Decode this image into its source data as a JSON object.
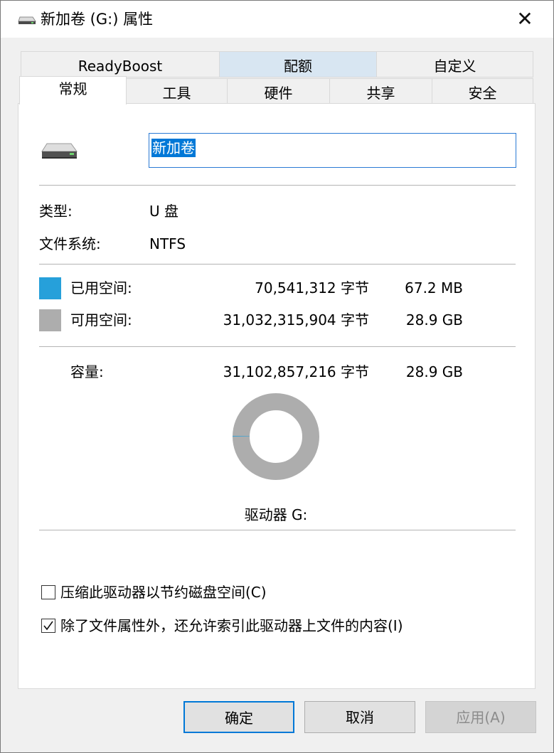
{
  "window": {
    "title": "新加卷 (G:) 属性",
    "close_symbol": "✕"
  },
  "tabs": {
    "row_back": [
      "ReadyBoost",
      "配额",
      "自定义"
    ],
    "row_front": [
      "常规",
      "工具",
      "硬件",
      "共享",
      "安全"
    ],
    "active": "常规",
    "hover": "配额"
  },
  "general": {
    "drive_icon": "usb-drive-icon",
    "volume_name": "新加卷",
    "type_label": "类型:",
    "type_value": "U 盘",
    "fs_label": "文件系统:",
    "fs_value": "NTFS",
    "used": {
      "label": "已用空间:",
      "bytes": "70,541,312 字节",
      "size": "67.2 MB",
      "color": "#26a0da"
    },
    "free": {
      "label": "可用空间:",
      "bytes": "31,032,315,904 字节",
      "size": "28.9 GB",
      "color": "#adadad"
    },
    "capacity": {
      "label": "容量:",
      "bytes": "31,102,857,216 字节",
      "size": "28.9 GB"
    },
    "used_fraction": 0.00227,
    "drive_label": "驱动器 G:",
    "compress_label": "压缩此驱动器以节约磁盘空间(C)",
    "compress_checked": false,
    "index_label": "除了文件属性外，还允许索引此驱动器上文件的内容(I)",
    "index_checked": true
  },
  "buttons": {
    "ok": "确定",
    "cancel": "取消",
    "apply": "应用(A)"
  }
}
